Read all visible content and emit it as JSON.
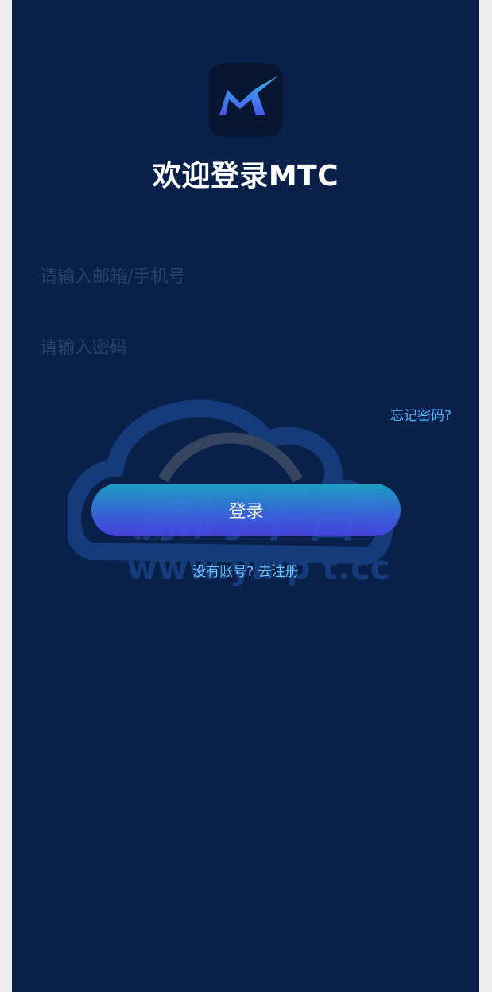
{
  "header": {
    "title": "欢迎登录MTC"
  },
  "form": {
    "account_placeholder": "请输入邮箱/手机号",
    "password_placeholder": "请输入密码",
    "forgot_label": "忘记密码?",
    "login_label": "登录",
    "register_label": "没有账号? 去注册"
  },
  "watermark": {
    "brand": "源码平台",
    "url": "www.ymp t.cc"
  },
  "colors": {
    "background": "#08204a",
    "accent": "#4ab4ff",
    "button_start": "#1ea9cc",
    "button_end": "#4a42e6"
  }
}
